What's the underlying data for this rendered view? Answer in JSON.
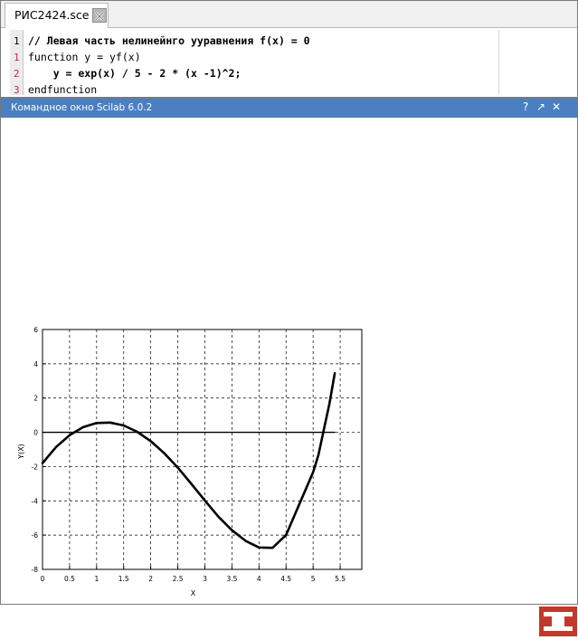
{
  "editor": {
    "tab_label": "РИС2424.sce",
    "close_icon": "close-icon",
    "line_numbers": [
      {
        "text": "1",
        "color": "#000000"
      },
      {
        "text": "1",
        "color": "#d02060"
      },
      {
        "text": "2",
        "color": "#d02060"
      },
      {
        "text": "3",
        "color": "#d02060"
      }
    ],
    "lines": [
      "// Левая часть нелинейнго ууравнения f(x) = 0",
      "function y = yf(x)",
      "    y = exp(x) / 5 - 2 * (x -1)^2;",
      "endfunction"
    ]
  },
  "console": {
    "title": "Командное окно Scilab 6.0.2",
    "help_icon": "?",
    "undock_icon": "↗",
    "close_icon": "✕",
    "bar_color": "#4a7fc1"
  },
  "chart_data": {
    "type": "line",
    "title": "",
    "xlabel": "X",
    "ylabel": "Y(X)",
    "xlim": [
      0,
      5.9
    ],
    "ylim": [
      -8,
      6
    ],
    "grid": true,
    "xticks": [
      "0",
      "0.5",
      "1",
      "1.5",
      "2",
      "2.5",
      "3",
      "3.5",
      "4",
      "4.5",
      "5",
      "5.5"
    ],
    "yticks": [
      "-8",
      "-6",
      "-4",
      "-2",
      "0",
      "2",
      "4",
      "6"
    ],
    "series": [
      {
        "x": [
          0,
          0.25,
          0.5,
          0.75,
          1,
          1.25,
          1.5,
          1.75,
          2,
          2.25,
          2.5,
          2.75,
          3,
          3.25,
          3.5,
          3.75,
          4,
          4.25,
          4.5,
          4.75,
          5,
          5.1,
          5.2,
          5.3,
          5.4
        ],
        "y": [
          -1.8,
          -0.86,
          -0.17,
          0.3,
          0.54,
          0.57,
          0.4,
          0.03,
          -0.52,
          -1.22,
          -2.06,
          -3.01,
          -3.98,
          -4.92,
          -5.71,
          -6.33,
          -6.72,
          -6.74,
          -6.0,
          -4.16,
          -2.32,
          -1.31,
          0.18,
          1.64,
          3.45
        ],
        "color": "#000000"
      },
      {
        "x": [
          0,
          5.4
        ],
        "y": [
          0,
          0
        ],
        "color": "#000000"
      }
    ]
  },
  "logo": {
    "icon": "publisher-logo-icon",
    "color": "#c0392b"
  }
}
